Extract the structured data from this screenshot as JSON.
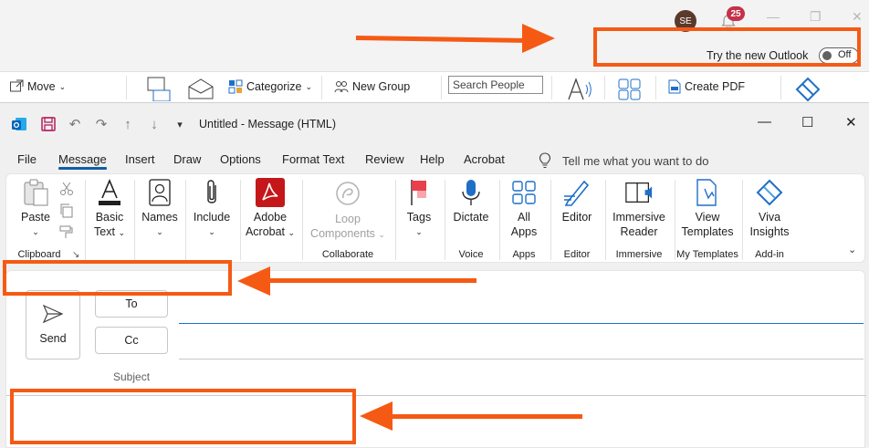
{
  "background_window": {
    "avatar_initials": "SE",
    "notification_count": "25",
    "try_new_outlook_label": "Try the new Outlook",
    "toggle_state": "Off",
    "ribbon": {
      "move_label": "Move",
      "categorize_label": "Categorize",
      "new_group_label": "New Group",
      "search_people_placeholder": "Search People",
      "create_pdf_label": "Create PDF"
    }
  },
  "message_window": {
    "title": "Untitled  -  Message (HTML)",
    "tabs": [
      {
        "label": "File"
      },
      {
        "label": "Message"
      },
      {
        "label": "Insert"
      },
      {
        "label": "Draw"
      },
      {
        "label": "Options"
      },
      {
        "label": "Format Text"
      },
      {
        "label": "Review"
      },
      {
        "label": "Help"
      },
      {
        "label": "Acrobat"
      }
    ],
    "active_tab": "Message",
    "tell_me": "Tell me what you want to do",
    "ribbon": {
      "paste": "Paste",
      "basic_text_1": "Basic",
      "basic_text_2": "Text",
      "names": "Names",
      "include": "Include",
      "adobe_acrobat_1": "Adobe",
      "adobe_acrobat_2": "Acrobat",
      "loop_components_1": "Loop",
      "loop_components_2": "Components",
      "tags": "Tags",
      "dictate": "Dictate",
      "all_apps_1": "All",
      "all_apps_2": "Apps",
      "editor": "Editor",
      "immersive_reader_1": "Immersive",
      "immersive_reader_2": "Reader",
      "view_templates_1": "View",
      "view_templates_2": "Templates",
      "viva_insights_1": "Viva",
      "viva_insights_2": "Insights",
      "groups": {
        "clipboard": "Clipboard",
        "collaborate": "Collaborate",
        "voice": "Voice",
        "apps": "Apps",
        "editor": "Editor",
        "immersive": "Immersive",
        "my_templates": "My Templates",
        "add_in": "Add-in"
      }
    },
    "compose": {
      "send_label": "Send",
      "to_label": "To",
      "cc_label": "Cc",
      "subject_label": "Subject"
    }
  },
  "colors": {
    "annotation": "#f55a14",
    "accent_blue": "#115ea3",
    "acrobat_red": "#c4171a"
  }
}
